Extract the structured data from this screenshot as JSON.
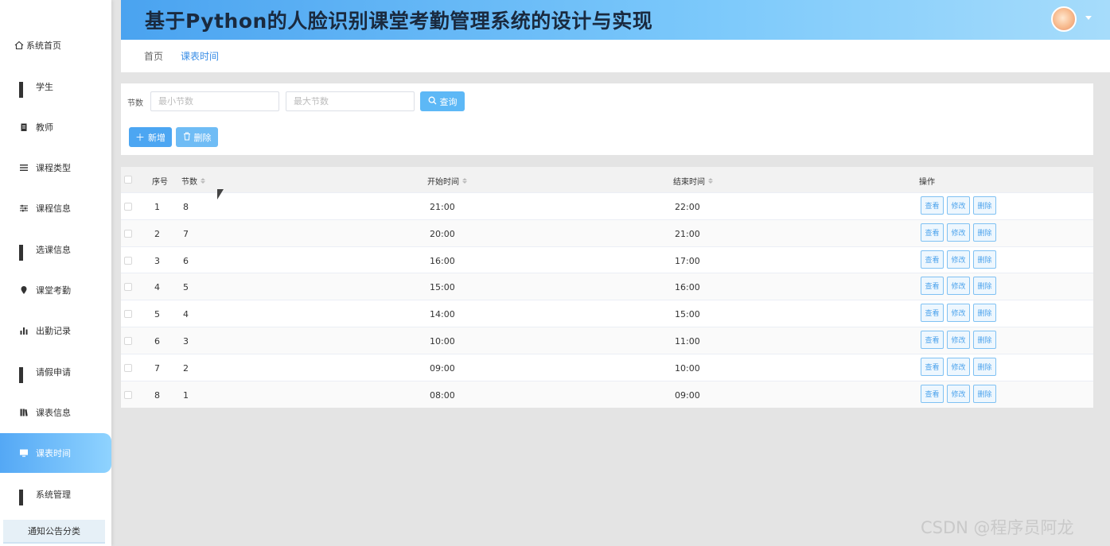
{
  "app": {
    "title": "基于Python的人脸识别课堂考勤管理系统的设计与实现"
  },
  "sidebar": {
    "items": [
      {
        "label": "系统首页",
        "icon": "home-icon"
      },
      {
        "label": "学生",
        "icon": "grid-icon"
      },
      {
        "label": "教师",
        "icon": "clipboard-icon"
      },
      {
        "label": "课程类型",
        "icon": "list-icon"
      },
      {
        "label": "课程信息",
        "icon": "sliders-icon"
      },
      {
        "label": "选课信息",
        "icon": "grid-icon"
      },
      {
        "label": "课堂考勤",
        "icon": "pin-icon"
      },
      {
        "label": "出勤记录",
        "icon": "bar-chart-icon"
      },
      {
        "label": "请假申请",
        "icon": "grid-icon"
      },
      {
        "label": "课表信息",
        "icon": "book-icon"
      },
      {
        "label": "课表时间",
        "icon": "monitor-icon",
        "active": true
      },
      {
        "label": "系统管理",
        "icon": "grid-icon"
      }
    ],
    "sub_item": "通知公告分类"
  },
  "breadcrumb": {
    "home": "首页",
    "current": "课表时间"
  },
  "search": {
    "label": "节数",
    "min_placeholder": "最小节数",
    "max_placeholder": "最大节数",
    "query_button": "查询",
    "add_button": "新增",
    "delete_button": "删除"
  },
  "table": {
    "headers": {
      "index": "序号",
      "section": "节数",
      "start": "开始时间",
      "end": "结束时间",
      "actions": "操作"
    },
    "action_labels": {
      "view": "查看",
      "edit": "修改",
      "delete": "删除"
    },
    "rows": [
      {
        "index": "1",
        "section": "8",
        "start": "21:00",
        "end": "22:00"
      },
      {
        "index": "2",
        "section": "7",
        "start": "20:00",
        "end": "21:00"
      },
      {
        "index": "3",
        "section": "6",
        "start": "16:00",
        "end": "17:00"
      },
      {
        "index": "4",
        "section": "5",
        "start": "15:00",
        "end": "16:00"
      },
      {
        "index": "5",
        "section": "4",
        "start": "14:00",
        "end": "15:00"
      },
      {
        "index": "6",
        "section": "3",
        "start": "10:00",
        "end": "11:00"
      },
      {
        "index": "7",
        "section": "2",
        "start": "09:00",
        "end": "10:00"
      },
      {
        "index": "8",
        "section": "1",
        "start": "08:00",
        "end": "09:00"
      }
    ]
  },
  "watermark": "CSDN @程序员阿龙",
  "colors": {
    "accent": "#4ca6f2",
    "header_start": "#4aa3f0",
    "header_end": "#a6dcfb"
  }
}
